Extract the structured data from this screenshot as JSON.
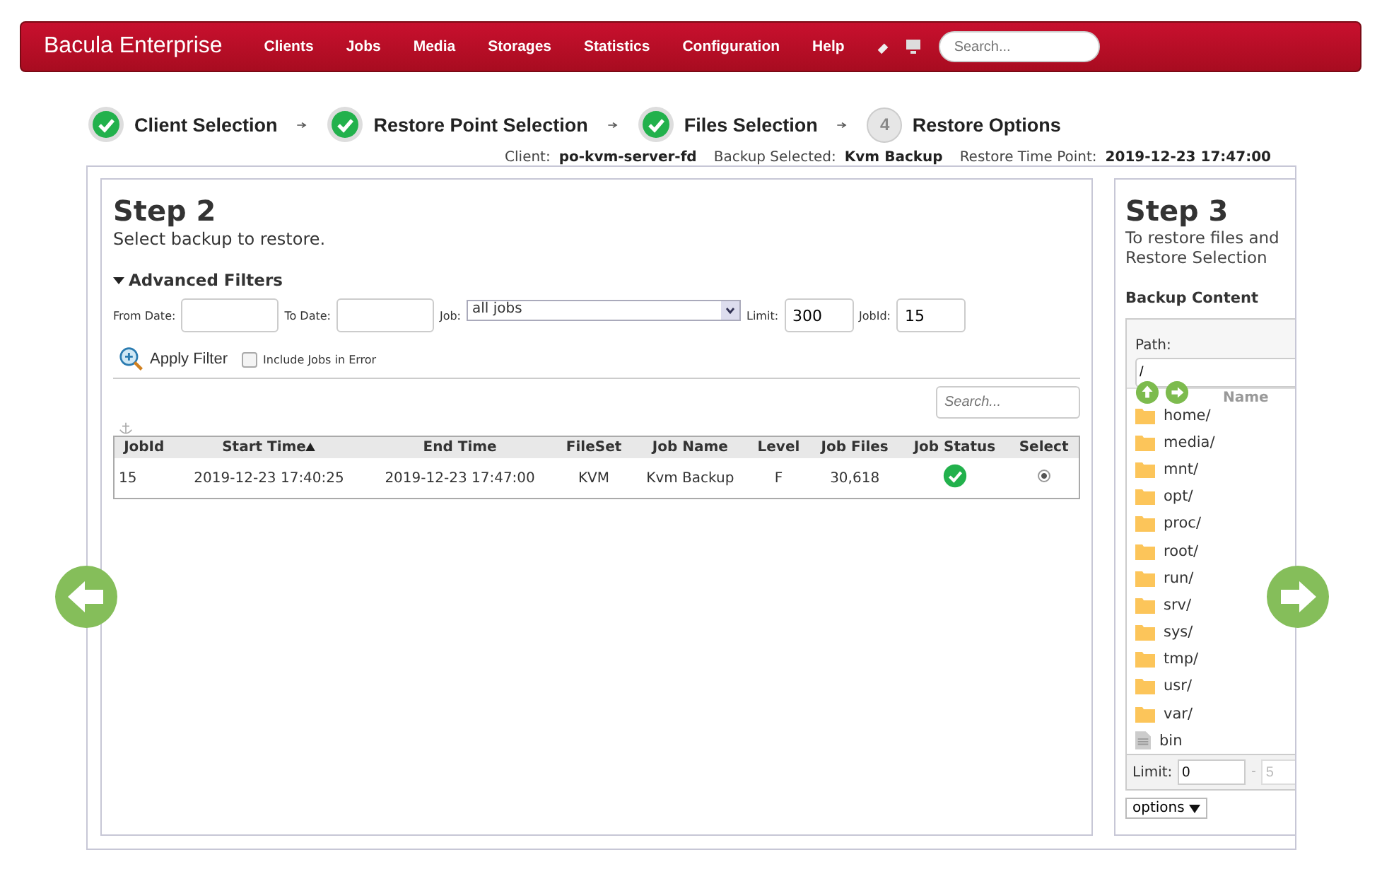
{
  "brand": "Bacula Enterprise",
  "nav": [
    "Clients",
    "Jobs",
    "Media",
    "Storages",
    "Statistics",
    "Configuration",
    "Help"
  ],
  "search": {
    "placeholder": "Search..."
  },
  "steps": [
    {
      "label": "Client Selection",
      "done": true
    },
    {
      "label": "Restore Point Selection",
      "done": true
    },
    {
      "label": "Files Selection",
      "done": true
    },
    {
      "number": "4",
      "label": "Restore Options",
      "done": false
    }
  ],
  "summary": [
    {
      "label": "Client:",
      "value": "po-kvm-server-fd"
    },
    {
      "label": "Backup Selected:",
      "value": "Kvm Backup"
    },
    {
      "label": "Restore Time Point:",
      "value": "2019-12-23 17:47:00"
    }
  ],
  "step2": {
    "title": "Step 2",
    "subtitle": "Select backup to restore.",
    "filters_title": "Advanced Filters",
    "filters_expanded": true,
    "from_date_label": "From Date:",
    "to_date_label": "To Date:",
    "job_label": "Job:",
    "job_value": "all jobs",
    "limit_label": "Limit:",
    "limit_value": "300",
    "jobid_label": "JobId:",
    "jobid_value": "15",
    "apply_label": "Apply Filter",
    "include_errors_label": "Include Jobs in Error",
    "include_errors_checked": false,
    "table_search_placeholder": "Search...",
    "columns": [
      {
        "label": "JobId",
        "sorted": false
      },
      {
        "label": "Start Time",
        "sorted": true
      },
      {
        "label": "End Time",
        "sorted": false
      },
      {
        "label": "FileSet",
        "sorted": false
      },
      {
        "label": "Job Name",
        "sorted": false
      },
      {
        "label": "Level",
        "sorted": false
      },
      {
        "label": "Job Files",
        "sorted": false
      },
      {
        "label": "Job Status",
        "sorted": false
      },
      {
        "label": "Select",
        "sorted": false
      }
    ],
    "rows": [
      {
        "jobid": "15",
        "start": "2019-12-23 17:40:25",
        "end": "2019-12-23 17:47:00",
        "fileset": "KVM",
        "job_name": "Kvm Backup",
        "level": "F",
        "job_files": "30,618",
        "status_ok": true,
        "selected": true
      }
    ]
  },
  "step3": {
    "title": "Step 3",
    "lines": [
      "To restore files and",
      "Restore Selection"
    ],
    "content_title": "Backup Content",
    "path_label": "Path:",
    "path_value": "/",
    "name_column": "Name",
    "files": [
      {
        "name": "home/",
        "kind": "folder"
      },
      {
        "name": "media/",
        "kind": "folder"
      },
      {
        "name": "mnt/",
        "kind": "folder"
      },
      {
        "name": "opt/",
        "kind": "folder"
      },
      {
        "name": "proc/",
        "kind": "folder"
      },
      {
        "name": "root/",
        "kind": "folder"
      },
      {
        "name": "run/",
        "kind": "folder"
      },
      {
        "name": "srv/",
        "kind": "folder"
      },
      {
        "name": "sys/",
        "kind": "folder"
      },
      {
        "name": "tmp/",
        "kind": "folder"
      },
      {
        "name": "usr/",
        "kind": "folder"
      },
      {
        "name": "var/",
        "kind": "folder"
      },
      {
        "name": "bin",
        "kind": "file"
      }
    ],
    "limit_label": "Limit:",
    "limit_from": "0",
    "limit_sep": "-",
    "limit_to": "5",
    "options_label": "options"
  }
}
